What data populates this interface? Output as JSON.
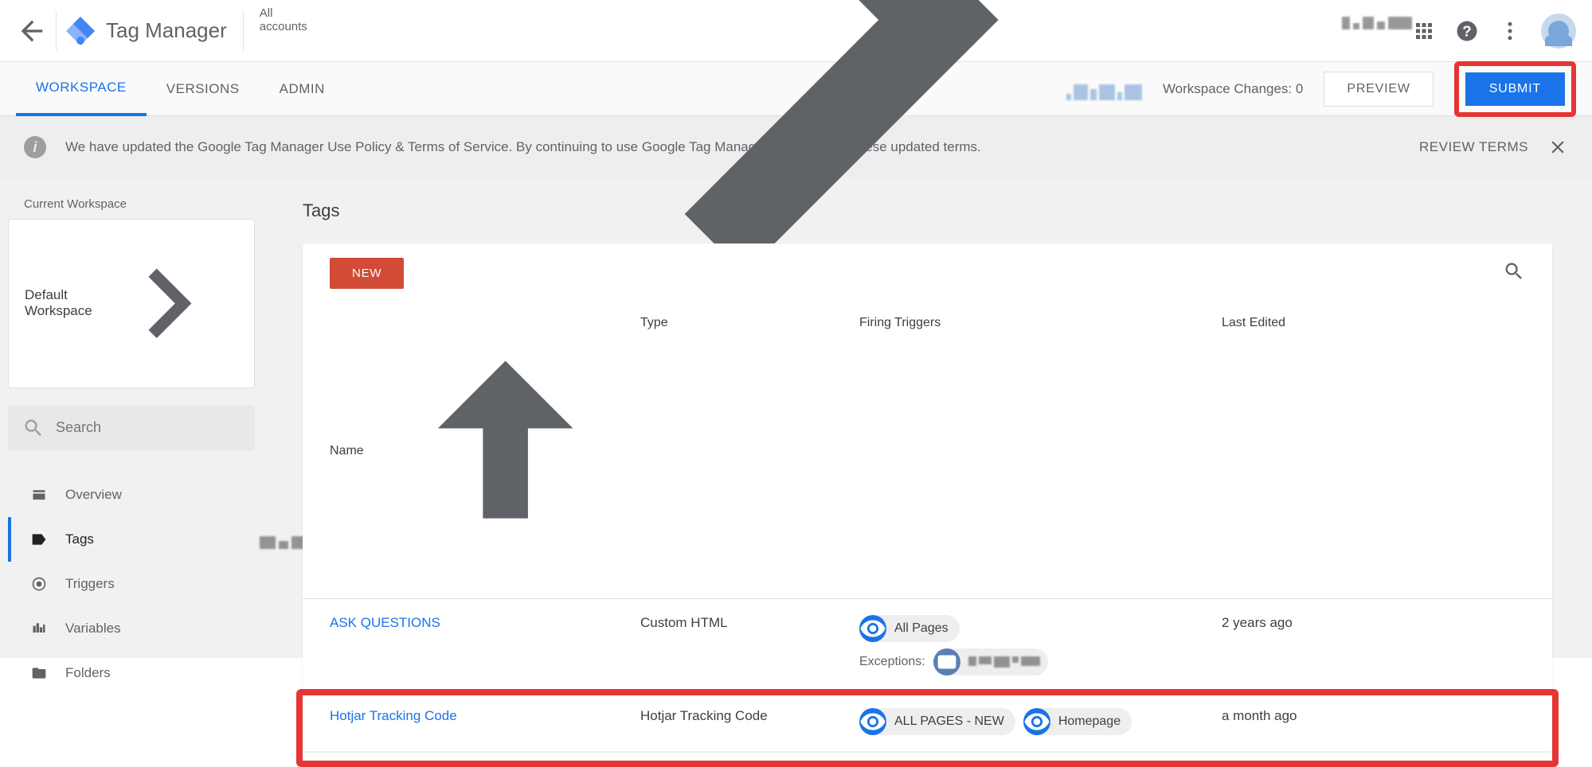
{
  "header": {
    "product_name": "Tag Manager",
    "breadcrumb_top": "All accounts"
  },
  "subheader": {
    "tabs": [
      {
        "label": "WORKSPACE",
        "active": true
      },
      {
        "label": "VERSIONS",
        "active": false
      },
      {
        "label": "ADMIN",
        "active": false
      }
    ],
    "changes_label": "Workspace Changes:",
    "changes_count": "0",
    "preview_label": "PREVIEW",
    "submit_label": "SUBMIT"
  },
  "notice": {
    "text": "We have updated the Google Tag Manager Use Policy & Terms of Service. By continuing to use Google Tag Manager, you agree to these updated terms.",
    "review_label": "REVIEW TERMS"
  },
  "sidebar": {
    "current_ws_label": "Current Workspace",
    "current_ws_value": "Default Workspace",
    "search_placeholder": "Search",
    "nav": [
      {
        "label": "Overview",
        "icon": "overview"
      },
      {
        "label": "Tags",
        "icon": "tag",
        "active": true
      },
      {
        "label": "Triggers",
        "icon": "trigger"
      },
      {
        "label": "Variables",
        "icon": "variable"
      },
      {
        "label": "Folders",
        "icon": "folder"
      }
    ]
  },
  "content": {
    "title": "Tags",
    "new_label": "NEW",
    "columns": {
      "name": "Name",
      "type": "Type",
      "triggers": "Firing Triggers",
      "edited": "Last Edited"
    },
    "rows": [
      {
        "name": "ASK QUESTIONS",
        "type": "Custom HTML",
        "triggers": [
          {
            "label": "All Pages"
          }
        ],
        "exceptions_label": "Exceptions:",
        "has_exceptions": true,
        "edited": "2 years ago",
        "highlighted": false
      },
      {
        "name": "Hotjar Tracking Code",
        "type": "Hotjar Tracking Code",
        "triggers": [
          {
            "label": "ALL PAGES - NEW"
          },
          {
            "label": "Homepage"
          }
        ],
        "has_exceptions": false,
        "edited": "a month ago",
        "highlighted": true
      }
    ]
  }
}
